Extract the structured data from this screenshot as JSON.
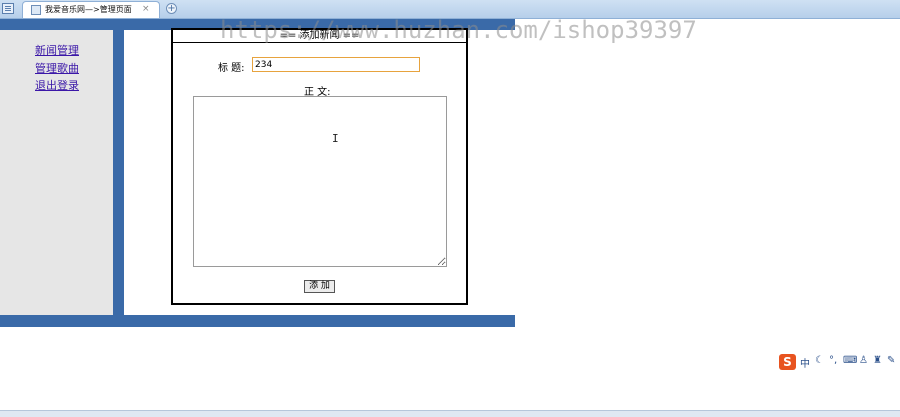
{
  "browser": {
    "tab_title": "我爱音乐网—>管理页面",
    "tab_close": "×",
    "new_tab": "+"
  },
  "sidebar": {
    "items": [
      {
        "label": "新闻管理"
      },
      {
        "label": "管理歌曲"
      },
      {
        "label": "退出登录"
      }
    ]
  },
  "form": {
    "heading": "== 添加新闻 ==",
    "title_label": "标  题:",
    "title_value": "234",
    "body_label": "正  文:",
    "body_value": "",
    "submit_label": "添 加"
  },
  "watermark": "https://www.huzhan.com/ishop39397",
  "ime": {
    "logo": "S",
    "mode": "中"
  },
  "colors": {
    "frame": "#3a6aa8",
    "sidebar_bg": "#e6e6e6",
    "link": "#3b17a8",
    "input_focus_border": "#e7a33e"
  }
}
